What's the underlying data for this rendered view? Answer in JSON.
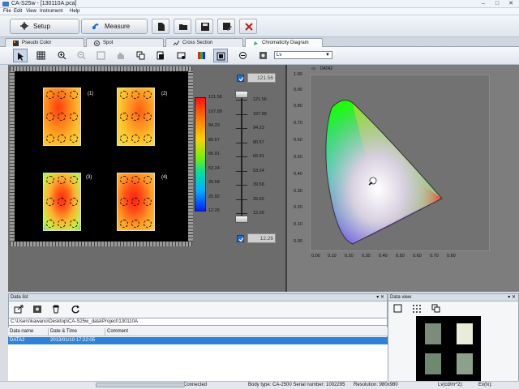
{
  "window": {
    "title": "CA-S25w - [130110A.pca]",
    "minimize": "–",
    "maximize": "□",
    "close": "✕"
  },
  "menu": [
    "File",
    "Edit",
    "View",
    "Instrument",
    "Help"
  ],
  "toolbar": {
    "setup_label": "Setup",
    "measure_label": "Measure",
    "icons": [
      "new-file-icon",
      "open-folder-icon",
      "save-icon",
      "save-as-icon",
      "disconnect-icon"
    ]
  },
  "tabs": [
    {
      "label": "Pseudo Color",
      "active": false
    },
    {
      "label": "Spot",
      "active": false
    },
    {
      "label": "Cross Section",
      "active": false
    },
    {
      "label": "Chromaticity Diagram",
      "active": true
    }
  ],
  "view_toolbar": {
    "value_select": "Lv",
    "icons": [
      "pointer-icon",
      "grid-icon",
      "zoom-in-icon",
      "zoom-out-icon",
      "fit-icon",
      "hand-icon",
      "copy-icon",
      "paste-icon",
      "settings-icon",
      "color-map-icon",
      "frame-icon",
      "rotate-icon",
      "options-icon"
    ]
  },
  "pseudo_color": {
    "samples": [
      "(1)",
      "(2)",
      "(3)",
      "(4)"
    ],
    "colorbar_labels": [
      "121.56",
      "107.89",
      "94.23",
      "80.57",
      "66.91",
      "53.24",
      "39.58",
      "25.92",
      "12.26"
    ],
    "slider_labels": [
      "121.56",
      "107.89",
      "94.23",
      "80.57",
      "66.91",
      "53.24",
      "39.58",
      "25.92",
      "12.26"
    ],
    "upper_value": "121.56",
    "lower_value": "12.26",
    "accent": "#1d6fd0"
  },
  "chromaticity": {
    "header": "DATA2",
    "y_ticks": [
      "1.00",
      "0.90",
      "0.80",
      "0.70",
      "0.60",
      "0.50",
      "0.40",
      "0.30",
      "0.20",
      "0.10",
      "0.00"
    ],
    "x_ticks": [
      "0.00",
      "0.10",
      "0.20",
      "0.30",
      "0.40",
      "0.50",
      "0.60",
      "0.70",
      "0.80"
    ]
  },
  "data_list": {
    "title": "Data list",
    "path": "C:\\Users\\kawano\\Desktop\\CA-S25w_data\\Project\\130110A",
    "columns": [
      "Data name",
      "Date & Time",
      "Comment"
    ],
    "rows": [
      {
        "name": "DATA2",
        "datetime": "2013/01/10 17:22:05",
        "comment": ""
      }
    ],
    "icons": [
      "export-icon",
      "settings-icon",
      "trash-icon",
      "refresh-icon"
    ]
  },
  "data_view": {
    "title": "Data view",
    "icons": [
      "frame-icon",
      "grid-icon",
      "copy-icon"
    ]
  },
  "status": {
    "connection": "Connected",
    "body_type": "Body type: CA-2500  Serial number: 1002295",
    "resolution": "Resolution: 980x980",
    "unit": "Lv(cd/m^2):",
    "ev": "Ev(lx):"
  }
}
